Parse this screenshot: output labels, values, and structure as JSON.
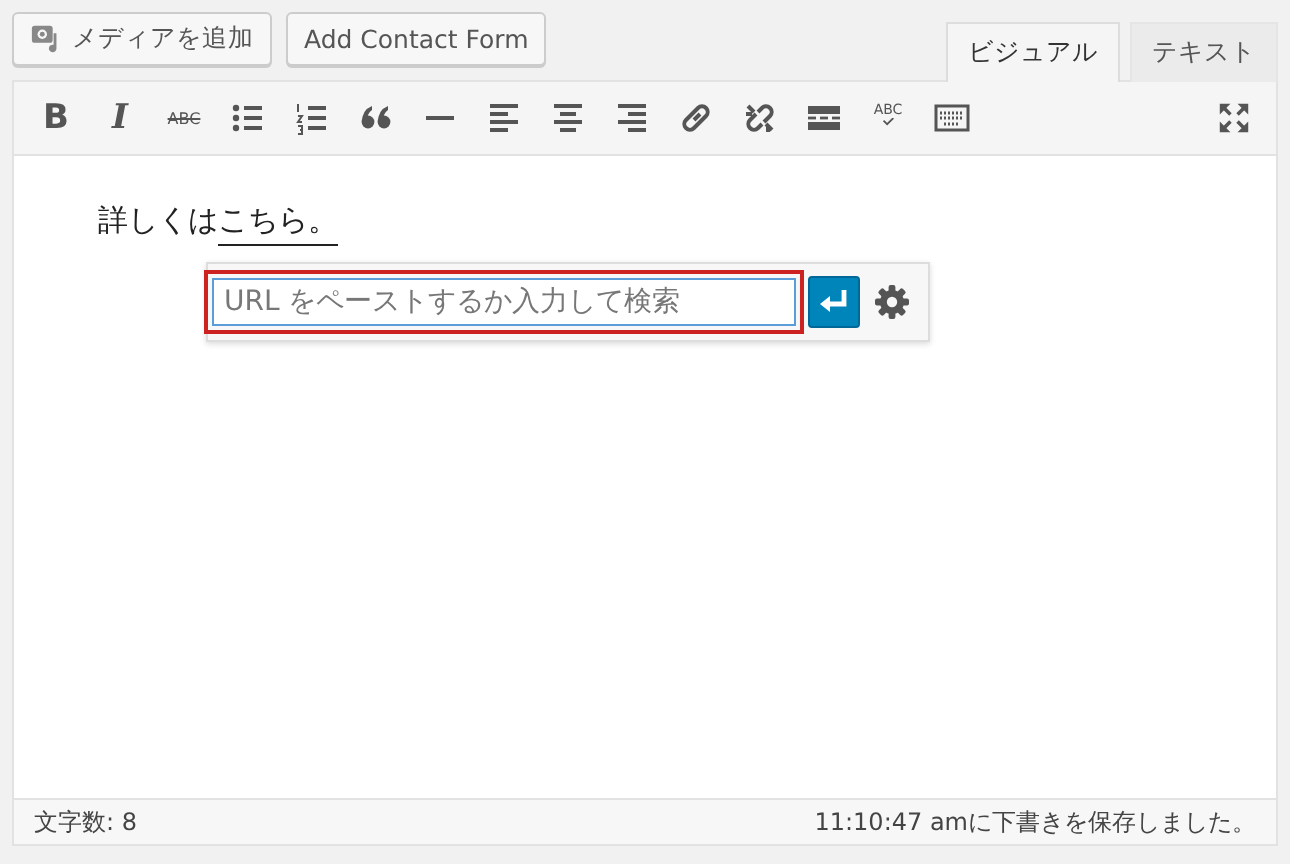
{
  "media_buttons": [
    {
      "kind": "media",
      "label": "メディアを追加"
    },
    {
      "kind": "plain",
      "label": "Add Contact Form"
    }
  ],
  "tabs": [
    {
      "label": "ビジュアル",
      "selected": true
    },
    {
      "label": "テキスト",
      "selected": false
    }
  ],
  "toolbar": [
    {
      "kind": "bold",
      "glyph": "B"
    },
    {
      "kind": "italic",
      "glyph": "I"
    },
    {
      "kind": "strike",
      "glyph": "ABC"
    },
    {
      "kind": "bullets"
    },
    {
      "kind": "numbers"
    },
    {
      "kind": "quote"
    },
    {
      "kind": "hr"
    },
    {
      "kind": "alignleft"
    },
    {
      "kind": "aligncenter"
    },
    {
      "kind": "alignright"
    },
    {
      "kind": "link"
    },
    {
      "kind": "unlink"
    },
    {
      "kind": "more"
    },
    {
      "kind": "spell",
      "glyph": "ABC"
    },
    {
      "kind": "keyboard"
    }
  ],
  "content": {
    "text": "詳しくは",
    "link": "こちら。"
  },
  "link_popup": {
    "placeholder": "URL をペーストするか入力して検索",
    "highlighted": true
  },
  "status_bar": {
    "word_count": "文字数: 8",
    "saved": "11:10:47 amに下書きを保存しました。"
  }
}
